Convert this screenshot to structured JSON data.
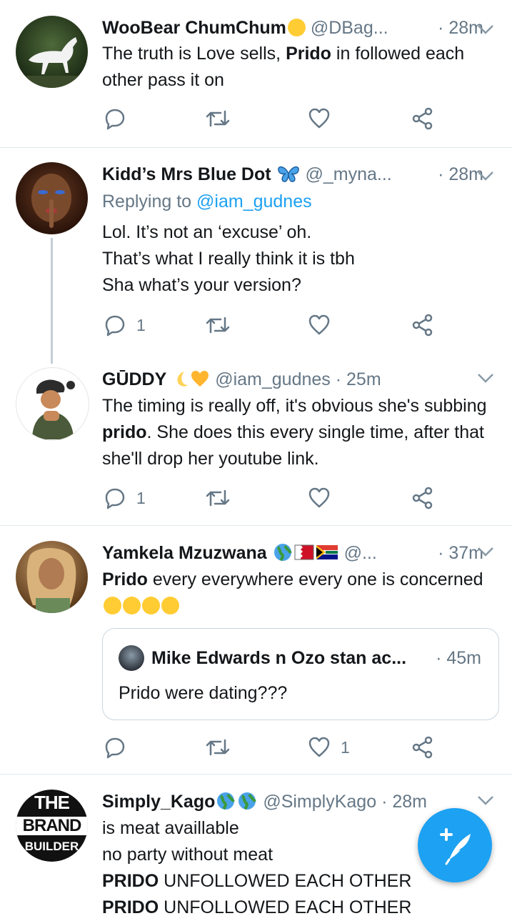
{
  "tweets": [
    {
      "name": "WooBear ChumChum",
      "handle": "@DBag...",
      "time": "· 28m",
      "text_parts": [
        "The truth is Love sells, ",
        "Prido",
        " in followed each other pass it on"
      ],
      "reply_count": "",
      "like_count": ""
    },
    {
      "name": "Kidd’s Mrs Blue Dot",
      "handle": "@_myna...",
      "time": "· 28m",
      "replying_prefix": "Replying to ",
      "replying_to": "@iam_gudnes",
      "lines": [
        "Lol. It’s not an ‘excuse’ oh.",
        "That’s what I really think it is tbh",
        "Sha what’s your version?"
      ],
      "reply_count": "1",
      "like_count": ""
    },
    {
      "name": "GŪDDY",
      "handle": "@iam_gudnes",
      "time": "· 25m",
      "text_parts": [
        "The timing is really off, it's obvious she's subbing ",
        "prido",
        ". She does this every single time, after that she'll drop her youtube link."
      ],
      "reply_count": "1",
      "like_count": ""
    },
    {
      "name": "Yamkela Mzuzwana",
      "handle": "@...",
      "time": "· 37m",
      "text_parts": [
        "Prido",
        " every everywhere every one is concerned"
      ],
      "quote": {
        "name": "Mike Edwards n Ozo stan ac...",
        "time": "· 45m",
        "text": "Prido were dating???"
      },
      "reply_count": "",
      "like_count": "1"
    },
    {
      "name": "Simply_Kago",
      "handle": "@SimplyKago",
      "time": "· 28m",
      "lines": [
        "is meat availlable",
        "no party without meat"
      ],
      "line3_parts": [
        "PRIDO",
        " UNFOLLOWED EACH OTHER"
      ],
      "line4_parts": [
        "PRIDO",
        " UNFOLLOWED EACH OTHER"
      ],
      "avatar_text": [
        "THE",
        "BRAND",
        "BUILDER"
      ]
    }
  ],
  "colors": {
    "accent": "#1da1f2",
    "muted": "#657786",
    "text": "#14171a",
    "divider": "#e1e8ed"
  },
  "icons": [
    "reply-icon",
    "retweet-icon",
    "like-icon",
    "share-icon",
    "chevron-down-icon",
    "compose-tweet-icon"
  ]
}
